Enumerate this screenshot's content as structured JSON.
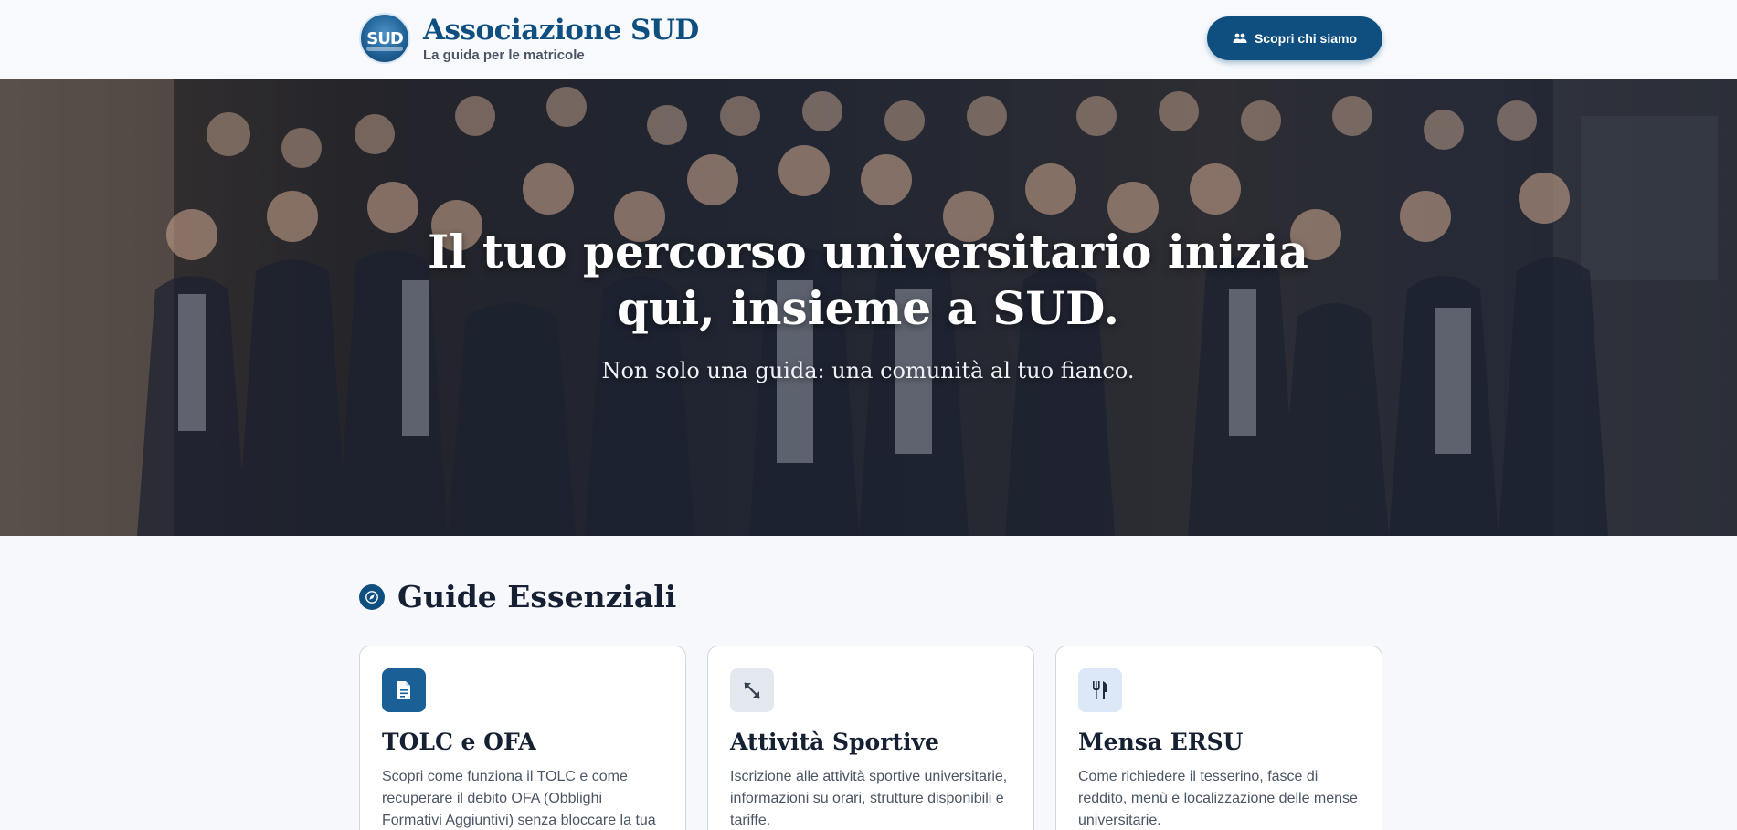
{
  "header": {
    "logo_text": "SUD",
    "title": "Associazione SUD",
    "subtitle": "La guida per le matricole",
    "cta_label": "Scopri chi siamo",
    "cta_icon": "group-icon"
  },
  "hero": {
    "title_line1": "Il tuo percorso universitario inizia",
    "title_line2": "qui, insieme a SUD.",
    "subtitle": "Non solo una guida: una comunità al tuo fianco."
  },
  "section": {
    "icon": "compass-icon",
    "title": "Guide Essenziali"
  },
  "cards": [
    {
      "icon": "document-icon",
      "title": "TOLC e OFA",
      "description": "Scopri come funziona il TOLC e come recuperare il debito OFA (Obblighi Formativi Aggiuntivi) senza bloccare la tua",
      "icon_bg": "#1a5f96",
      "icon_color": "#ffffff"
    },
    {
      "icon": "expand-arrows-icon",
      "title": "Attività Sportive",
      "description": "Iscrizione alle attività sportive universitarie, informazioni su orari, strutture disponibili e tariffe.",
      "icon_bg": "#e3e8ee",
      "icon_color": "#374151"
    },
    {
      "icon": "fork-knife-icon",
      "title": "Mensa ERSU",
      "description": "Come richiedere il tesserino, fasce di reddito, menù e localizzazione delle mense universitarie.",
      "icon_bg": "#dce8f7",
      "icon_color": "#1f2a3a"
    }
  ],
  "colors": {
    "brand": "#0f4f7f",
    "background": "#f6f8fb",
    "text_dark": "#152033",
    "text_muted": "#4b5563"
  }
}
